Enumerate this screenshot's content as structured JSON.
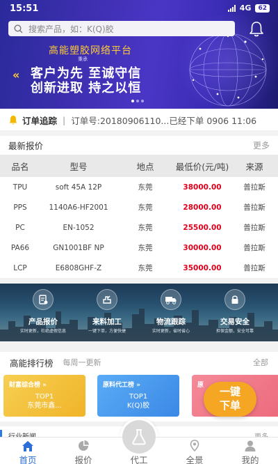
{
  "status_bar": {
    "time": "15:51",
    "network": "4G",
    "battery": "62"
  },
  "search": {
    "placeholder": "搜索产品，如：K(Q)胶"
  },
  "banner": {
    "title": "高能塑胶网络平台",
    "subtitle": "秉承",
    "line1": "客户为先 至诚守信",
    "line2": "创新进取 持之以恒"
  },
  "order_tracking": {
    "label": "订单追踪",
    "separator": "|",
    "text": "订单号:20180906110...已经下单  0906 11:06"
  },
  "quotes": {
    "title": "最新报价",
    "more": "更多",
    "columns": [
      "品名",
      "型号",
      "地点",
      "最低价(元/吨)",
      "来源"
    ],
    "rows": [
      [
        "TPU",
        "soft 45A 12P",
        "东莞",
        "38000.00",
        "普拉斯"
      ],
      [
        "PPS",
        "1140A6-HF2001",
        "东莞",
        "28000.00",
        "普拉斯"
      ],
      [
        "PC",
        "EN-1052",
        "东莞",
        "25500.00",
        "普拉斯"
      ],
      [
        "PA66",
        "GN1001BF NP",
        "东莞",
        "30000.00",
        "普拉斯"
      ],
      [
        "LCP",
        "E6808GHF-Z",
        "东莞",
        "35000.00",
        "普拉斯"
      ]
    ]
  },
  "features": [
    {
      "title": "产品报价",
      "desc": "实时更新，杜绝虚假信息",
      "icon": "quote-doc-icon"
    },
    {
      "title": "来料加工",
      "desc": "一键下单，方便快捷",
      "icon": "machine-icon"
    },
    {
      "title": "物流跟踪",
      "desc": "实时更新，省时省心",
      "icon": "truck-icon"
    },
    {
      "title": "交易安全",
      "desc": "担保金额，安全可靠",
      "icon": "lock-icon"
    }
  ],
  "ranking": {
    "title": "高能排行榜",
    "update": "每周一更新",
    "all": "全部",
    "cards": [
      {
        "title": "财富综合榜 »",
        "line1": "TOP1",
        "line2": "东莞市鑫...",
        "color": "#f5c13d"
      },
      {
        "title": "原料代工榜 »",
        "line1": "TOP1",
        "line2": "K(Q)胶",
        "color": "#4a9df2"
      },
      {
        "title": "原",
        "line1": "",
        "line2": "",
        "color": "#f07a8a"
      }
    ]
  },
  "float_button": {
    "line1": "一键",
    "line2": "下单"
  },
  "peek": {
    "title": "行业新闻",
    "more": "更多"
  },
  "nav": {
    "items": [
      {
        "label": "首页",
        "icon": "home-icon"
      },
      {
        "label": "报价",
        "icon": "pie-chart-icon"
      },
      {
        "label": "代工",
        "icon": "flask-icon"
      },
      {
        "label": "全景",
        "icon": "location-icon"
      },
      {
        "label": "我的",
        "icon": "user-icon"
      }
    ]
  },
  "colors": {
    "accent": "#2d6fd6",
    "price": "#e0001b",
    "float": "#f5a623"
  }
}
